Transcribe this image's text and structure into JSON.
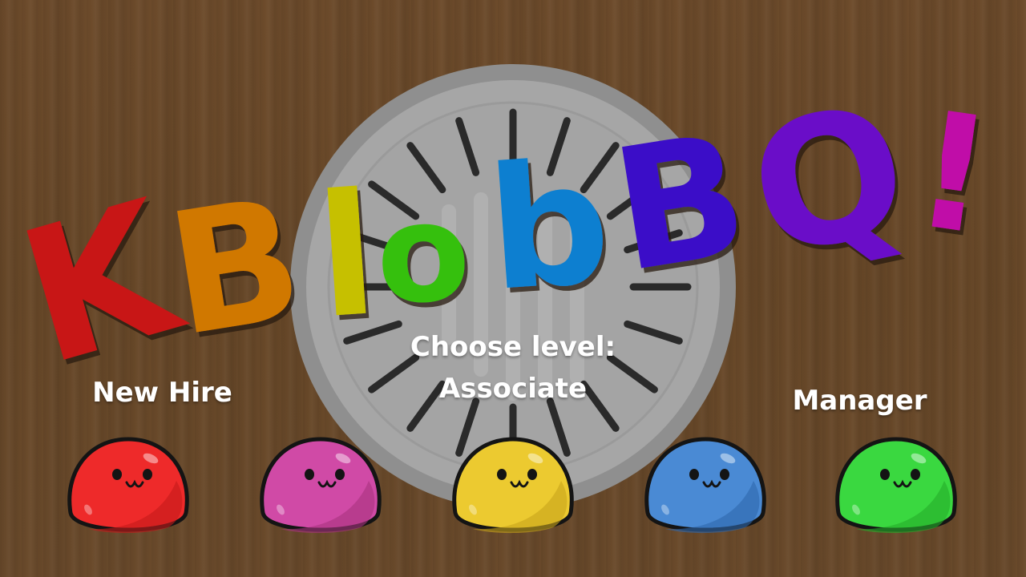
{
  "title": {
    "letters": [
      {
        "char": "K",
        "color": "#c81414"
      },
      {
        "char": "B",
        "color": "#d07800"
      },
      {
        "char": "l",
        "color": "#c6c000"
      },
      {
        "char": "o",
        "color": "#34c00a"
      },
      {
        "char": "b",
        "color": "#0a7fd0"
      },
      {
        "char": "B",
        "color": "#3a10c8"
      },
      {
        "char": "Q",
        "color": "#6a10c8"
      },
      {
        "char": "!",
        "color": "#c010a8"
      }
    ]
  },
  "prompt": {
    "label": "Choose level:",
    "current_level": "Associate"
  },
  "levels": {
    "left_label": "New Hire",
    "right_label": "Manager"
  },
  "blobs": [
    {
      "name": "red",
      "color": "#ee2a2a",
      "shade": "#c41a1a"
    },
    {
      "name": "pink",
      "color": "#d04aa6",
      "shade": "#a8347e"
    },
    {
      "name": "yellow",
      "color": "#ecca30",
      "shade": "#c8a41a"
    },
    {
      "name": "blue",
      "color": "#4a8ad4",
      "shade": "#2f68ac"
    },
    {
      "name": "green",
      "color": "#3ad840",
      "shade": "#24ae2a"
    }
  ],
  "colors": {
    "wood": "#6b4a2a",
    "grill": "#9a9a9a",
    "grill_inner": "#a9a9a9",
    "outline": "#141414"
  }
}
